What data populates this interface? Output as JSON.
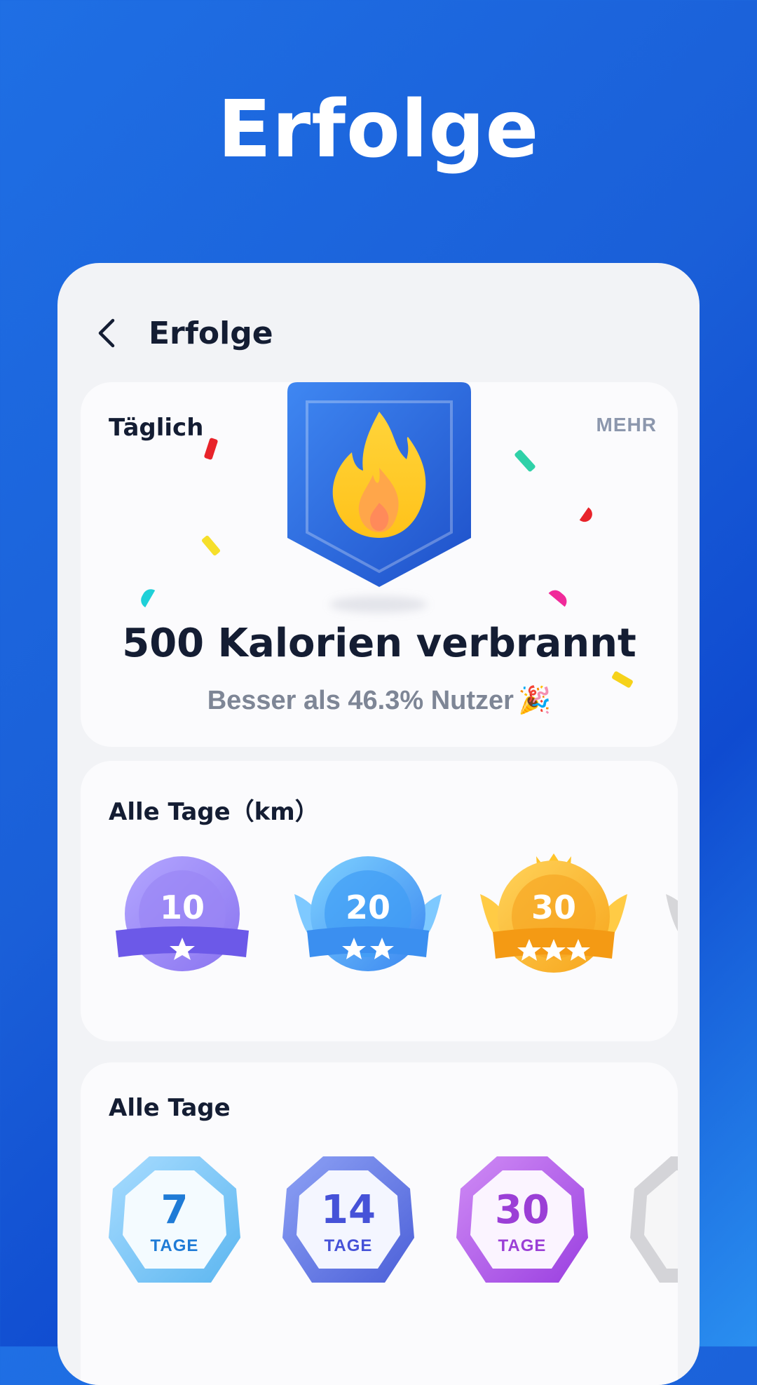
{
  "hero": {
    "title": "Erfolge"
  },
  "topbar": {
    "title": "Erfolge"
  },
  "daily": {
    "label": "Täglich",
    "more": "MEHR",
    "headline": "500 Kalorien verbrannt",
    "subtitle": "Besser als 46.3%  Nutzer",
    "emoji": "🎉"
  },
  "km": {
    "label": "Alle Tage（km）",
    "badges": [
      {
        "value": "10",
        "stars": 1
      },
      {
        "value": "20",
        "stars": 2
      },
      {
        "value": "30",
        "stars": 3
      }
    ]
  },
  "days": {
    "label": "Alle Tage",
    "badges": [
      {
        "value": "7",
        "unit": "TAGE",
        "color": "#1f7bd6"
      },
      {
        "value": "14",
        "unit": "TAGE",
        "color": "#4652d8"
      },
      {
        "value": "30",
        "unit": "TAGE",
        "color": "#9b3fd6"
      }
    ]
  },
  "colors": {
    "background": "#1a5fd8",
    "card": "#fbfbfd",
    "text": "#141d33",
    "muted": "#7e8696"
  }
}
